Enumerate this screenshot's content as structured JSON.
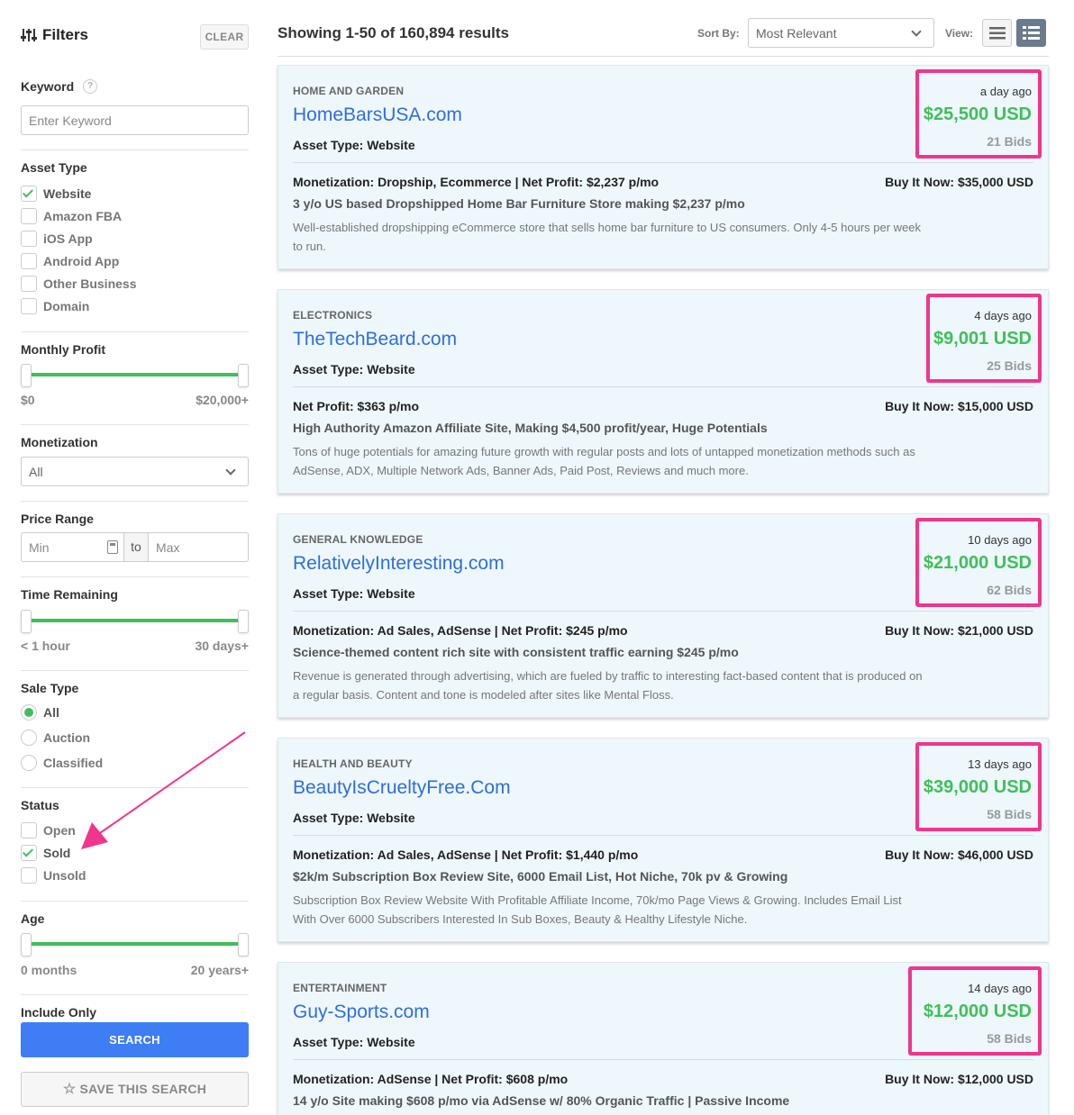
{
  "sidebar": {
    "title": "Filters",
    "clear_label": "CLEAR",
    "keyword_label": "Keyword",
    "keyword_help": "?",
    "keyword_placeholder": "Enter Keyword",
    "asset_type": {
      "label": "Asset Type",
      "options": [
        {
          "label": "Website",
          "checked": true
        },
        {
          "label": "Amazon FBA",
          "checked": false
        },
        {
          "label": "iOS App",
          "checked": false
        },
        {
          "label": "Android App",
          "checked": false
        },
        {
          "label": "Other Business",
          "checked": false
        },
        {
          "label": "Domain",
          "checked": false
        }
      ]
    },
    "monthly_profit": {
      "label": "Monthly Profit",
      "min": "$0",
      "max": "$20,000+"
    },
    "monetization": {
      "label": "Monetization",
      "value": "All"
    },
    "price_range": {
      "label": "Price Range",
      "min_placeholder": "Min",
      "to": "to",
      "max_placeholder": "Max"
    },
    "time_remaining": {
      "label": "Time Remaining",
      "min": "< 1 hour",
      "max": "30 days+"
    },
    "sale_type": {
      "label": "Sale Type",
      "options": [
        {
          "label": "All",
          "selected": true
        },
        {
          "label": "Auction",
          "selected": false
        },
        {
          "label": "Classified",
          "selected": false
        }
      ]
    },
    "status": {
      "label": "Status",
      "options": [
        {
          "label": "Open",
          "checked": false
        },
        {
          "label": "Sold",
          "checked": true
        },
        {
          "label": "Unsold",
          "checked": false
        }
      ]
    },
    "age": {
      "label": "Age",
      "min": "0 months",
      "max": "20 years+"
    },
    "include_only": {
      "label": "Include Only"
    },
    "search_label": "SEARCH",
    "save_label": "SAVE THIS SEARCH",
    "save_icon": "star-icon"
  },
  "results": {
    "heading": "Showing 1-50 of 160,894 results",
    "sort_label": "Sort By:",
    "sort_value": "Most Relevant",
    "view_label": "View:"
  },
  "colors": {
    "accent": "#3f7df5",
    "price": "#3fbf5a",
    "highlight": "#f0368c",
    "title_link": "#2f6de0"
  },
  "listings": [
    {
      "category": "HOME AND GARDEN",
      "title": "HomeBarsUSA.com",
      "asset_type": "Asset Type: Website",
      "ago": "a day ago",
      "price": "$25,500 USD",
      "bids": "21 Bids",
      "monetization": "Monetization: Dropship, Ecommerce | Net Profit: $2,237 p/mo",
      "buy_now": "Buy It Now: $35,000 USD",
      "headline": "3 y/o US based Dropshipped Home Bar Furniture Store making $2,237 p/mo",
      "description": "Well-established dropshipping eCommerce store that sells home bar furniture to US consumers. Only 4-5 hours per week to run."
    },
    {
      "category": "ELECTRONICS",
      "title": "TheTechBeard.com",
      "asset_type": "Asset Type: Website",
      "ago": "4 days ago",
      "price": "$9,001 USD",
      "bids": "25 Bids",
      "monetization": "Net Profit: $363 p/mo",
      "buy_now": "Buy It Now: $15,000 USD",
      "headline": "High Authority Amazon Affiliate Site, Making $4,500 profit/year, Huge Potentials",
      "description": "Tons of huge potentials for amazing future growth with regular posts and lots of untapped monetization methods such as AdSense, ADX, Multiple Network Ads, Banner Ads, Paid Post, Reviews and much more."
    },
    {
      "category": "GENERAL KNOWLEDGE",
      "title": "RelativelyInteresting.com",
      "asset_type": "Asset Type: Website",
      "ago": "10 days ago",
      "price": "$21,000 USD",
      "bids": "62 Bids",
      "monetization": "Monetization: Ad Sales, AdSense | Net Profit: $245 p/mo",
      "buy_now": "Buy It Now: $21,000 USD",
      "headline": "Science-themed content rich site with consistent traffic earning $245 p/mo",
      "description": "Revenue is generated through advertising, which are fueled by traffic to interesting fact-based content that is produced on a regular basis. Content and tone is modeled after sites like Mental Floss."
    },
    {
      "category": "HEALTH AND BEAUTY",
      "title": "BeautyIsCrueltyFree.Com",
      "asset_type": "Asset Type: Website",
      "ago": "13 days ago",
      "price": "$39,000 USD",
      "bids": "58 Bids",
      "monetization": "Monetization: Ad Sales, AdSense | Net Profit: $1,440 p/mo",
      "buy_now": "Buy It Now: $46,000 USD",
      "headline": "$2k/m Subscription Box Review Site, 6000 Email List, Hot Niche, 70k pv & Growing",
      "description": "Subscription Box Review Website With Profitable Affiliate Income, 70k/mo Page Views & Growing. Includes Email List With Over 6000 Subscribers Interested In Sub Boxes, Beauty & Healthy Lifestyle Niche."
    },
    {
      "category": "ENTERTAINMENT",
      "title": "Guy-Sports.com",
      "asset_type": "Asset Type: Website",
      "ago": "14 days ago",
      "price": "$12,000 USD",
      "bids": "58 Bids",
      "monetization": "Monetization: AdSense | Net Profit: $608 p/mo",
      "buy_now": "Buy It Now: $12,000 USD",
      "headline": "14 y/o Site making $608 p/mo via AdSense w/ 80% Organic Traffic | Passive Income",
      "description": ""
    }
  ]
}
